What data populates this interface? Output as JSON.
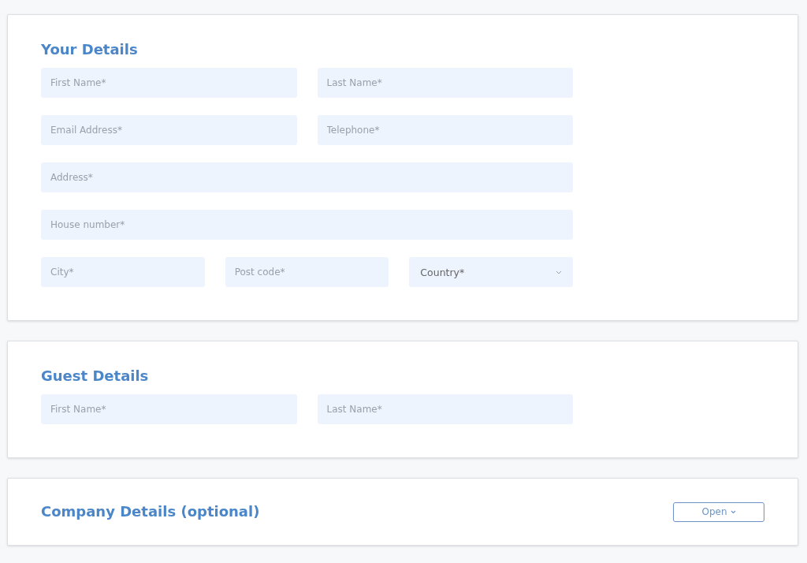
{
  "sections": [
    {
      "title": "Your Details",
      "rows": [
        [
          {
            "kind": "text",
            "placeholder": "First Name*"
          },
          {
            "kind": "text",
            "placeholder": "Last Name*"
          }
        ],
        [
          {
            "kind": "text",
            "placeholder": "Email Address*"
          },
          {
            "kind": "text",
            "placeholder": "Telephone*"
          }
        ],
        [
          {
            "kind": "text",
            "placeholder": "Address*"
          }
        ],
        [
          {
            "kind": "text",
            "placeholder": "House number*"
          }
        ],
        [
          {
            "kind": "text",
            "placeholder": "City*"
          },
          {
            "kind": "text",
            "placeholder": "Post code*"
          },
          {
            "kind": "select",
            "placeholder": "Country*"
          }
        ]
      ]
    },
    {
      "title": "Guest Details",
      "rows": [
        [
          {
            "kind": "text",
            "placeholder": "First Name*"
          },
          {
            "kind": "text",
            "placeholder": "Last Name*"
          }
        ]
      ]
    },
    {
      "title": "Company Details (optional)",
      "button": {
        "label": "Open"
      }
    }
  ]
}
